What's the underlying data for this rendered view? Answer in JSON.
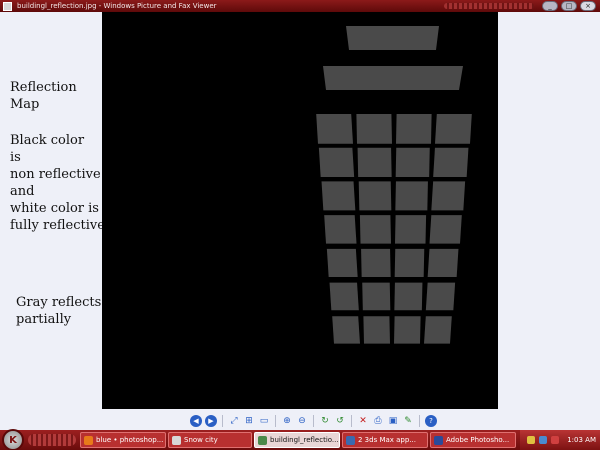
{
  "window": {
    "title": "buildingl_reflection.jpg - Windows Picture and Fax Viewer",
    "minimize": "_",
    "maximize": "□",
    "close": "×"
  },
  "annotations": {
    "reflection_map": [
      "Reflection",
      "Map"
    ],
    "black_white": [
      "Black color",
      "is",
      "non reflective",
      "and",
      "white color is",
      "fully reflective"
    ],
    "gray": [
      "Gray reflects",
      "partially"
    ]
  },
  "colors": {
    "titlebar": "#8c1a1a",
    "canvas_bg": "#000000",
    "panel_gray": "#4a4a4a",
    "taskbar": "#8a1818"
  },
  "toolbar": {
    "buttons": [
      {
        "name": "previous-image-icon",
        "glyph": "◀",
        "style": "nav"
      },
      {
        "name": "next-image-icon",
        "glyph": "▶",
        "style": "nav"
      },
      {
        "name": "best-fit-icon",
        "glyph": "⤢",
        "style": "blue"
      },
      {
        "name": "actual-size-icon",
        "glyph": "⊞",
        "style": "blue"
      },
      {
        "name": "slideshow-icon",
        "glyph": "▭",
        "style": "blue"
      },
      {
        "name": "zoom-in-icon",
        "glyph": "⊕",
        "style": "blue"
      },
      {
        "name": "zoom-out-icon",
        "glyph": "⊖",
        "style": "blue"
      },
      {
        "name": "rotate-clockwise-icon",
        "glyph": "↻",
        "style": "green"
      },
      {
        "name": "rotate-counterclockwise-icon",
        "glyph": "↺",
        "style": "green"
      },
      {
        "name": "delete-icon",
        "glyph": "✕",
        "style": "red"
      },
      {
        "name": "print-icon",
        "glyph": "⎙",
        "style": "blue"
      },
      {
        "name": "copy-to-icon",
        "glyph": "▣",
        "style": "blue"
      },
      {
        "name": "edit-icon",
        "glyph": "✎",
        "style": "green"
      },
      {
        "name": "help-icon",
        "glyph": "?",
        "style": "nav"
      }
    ]
  },
  "taskbar": {
    "start_glyph": "K",
    "tasks": [
      {
        "label": "blue • photoshop...",
        "icon_color": "#e87a1a",
        "active": false
      },
      {
        "label": "Snow city",
        "icon_color": "#d8d8d8",
        "active": false
      },
      {
        "label": "buildingl_reflectio...",
        "icon_color": "#4a8a4a",
        "active": true
      },
      {
        "label": "2 3ds Max app...",
        "icon_color": "#3a6ab0",
        "active": false
      },
      {
        "label": "Adobe Photosho...",
        "icon_color": "#2a4a9a",
        "active": false
      }
    ],
    "clock": "1:03 AM",
    "tray_icons": [
      "#e0c040",
      "#4a8ad0",
      "#d04040"
    ]
  }
}
